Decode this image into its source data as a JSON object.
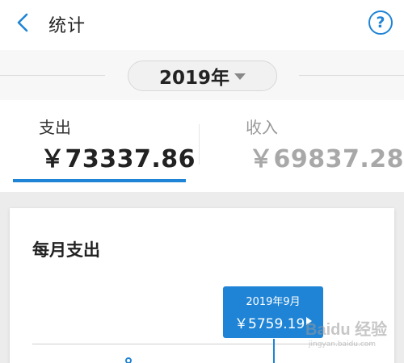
{
  "header": {
    "back_icon": "chevron-left-icon",
    "title": "统计",
    "help_label": "?",
    "accent_color": "#1f84d6"
  },
  "year_selector": {
    "value": "2019年",
    "icon": "caret-down-icon"
  },
  "summary": {
    "selected_tab": "expense",
    "expense": {
      "label": "支出",
      "amount": "￥73337.86"
    },
    "income": {
      "label": "收入",
      "amount": "￥69837.28"
    }
  },
  "monthly_card": {
    "title": "每月支出",
    "tooltip": {
      "month": "2019年9月",
      "value": "￥5759.19",
      "icon": "play-arrow-icon"
    }
  },
  "watermark": {
    "main": "Baidu 经验",
    "sub": "jingyan.baidu.com"
  }
}
